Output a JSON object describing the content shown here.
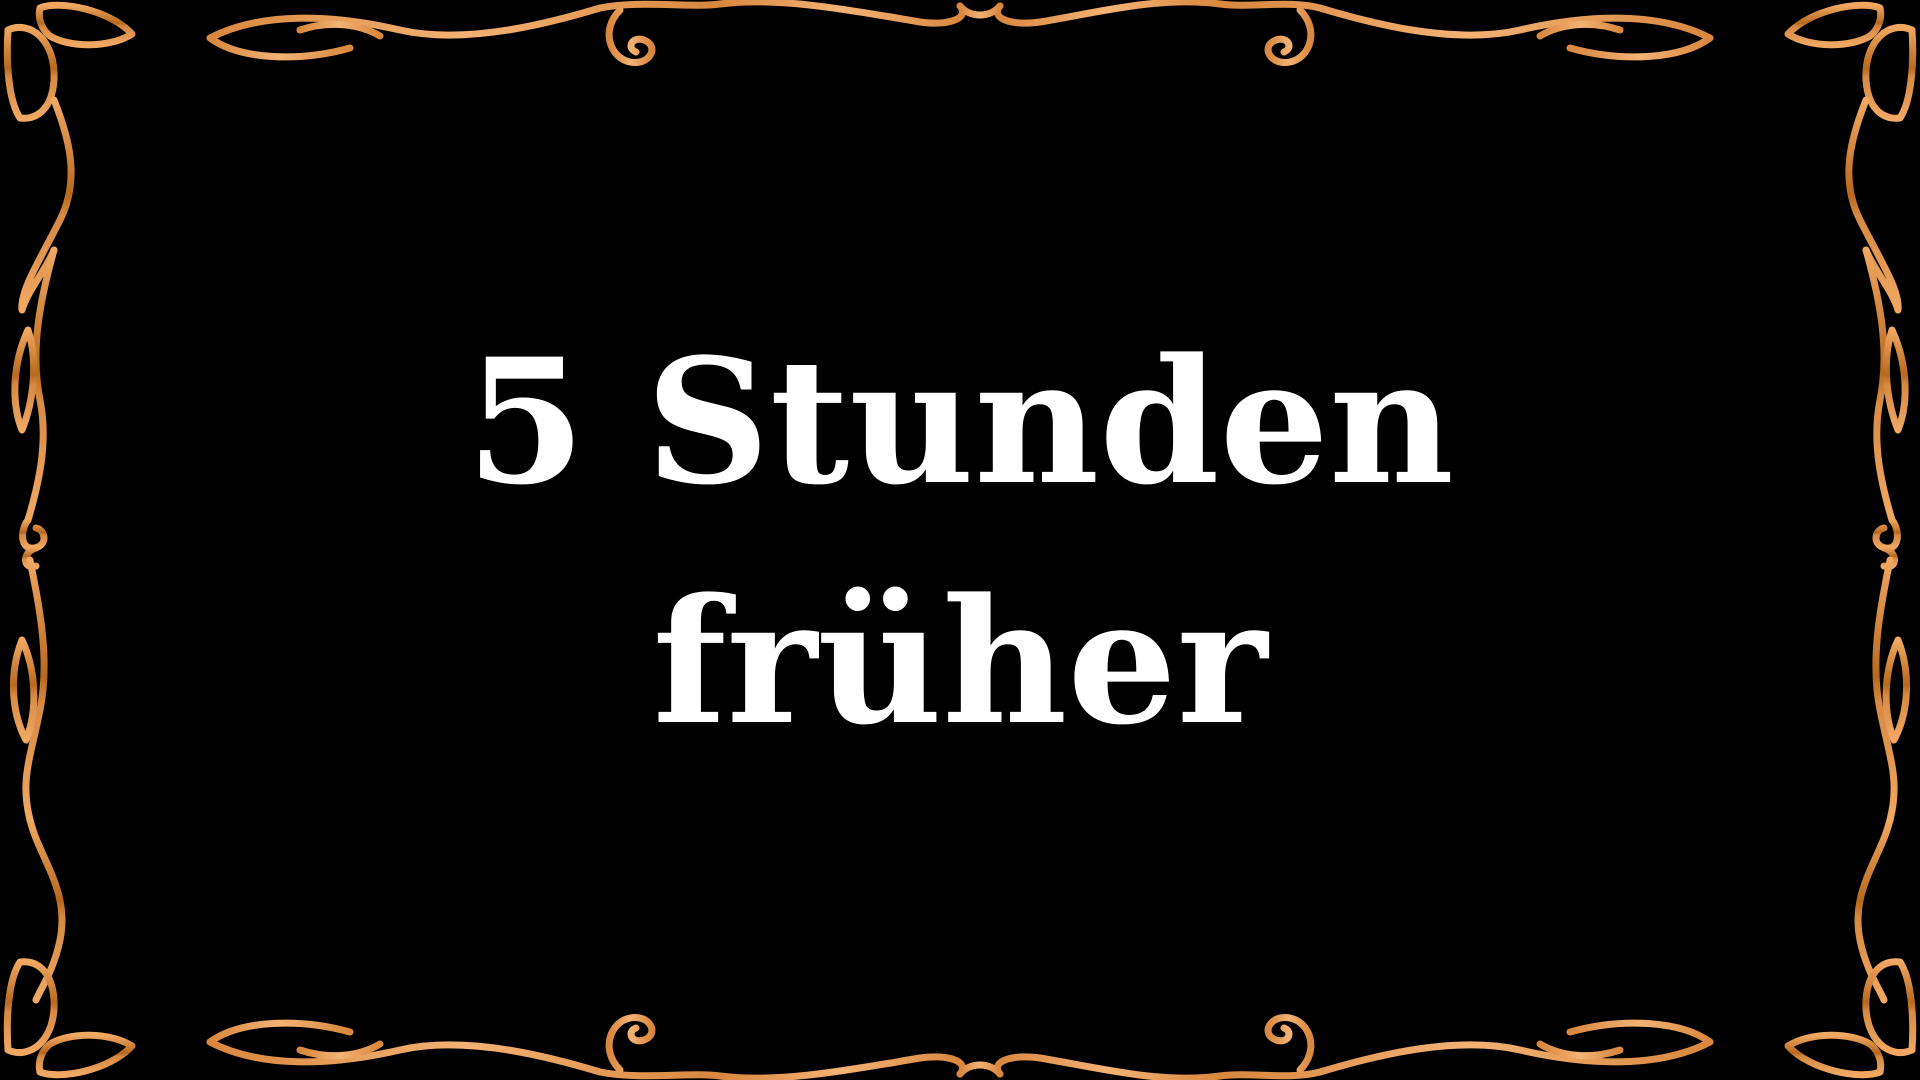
{
  "caption": {
    "line1": "5 Stunden",
    "line2": "früher"
  },
  "colors": {
    "background": "#000000",
    "text": "#ffffff",
    "ornament_light": "#f2b070",
    "ornament_mid": "#e0914a",
    "ornament_dark": "#a8601c"
  }
}
